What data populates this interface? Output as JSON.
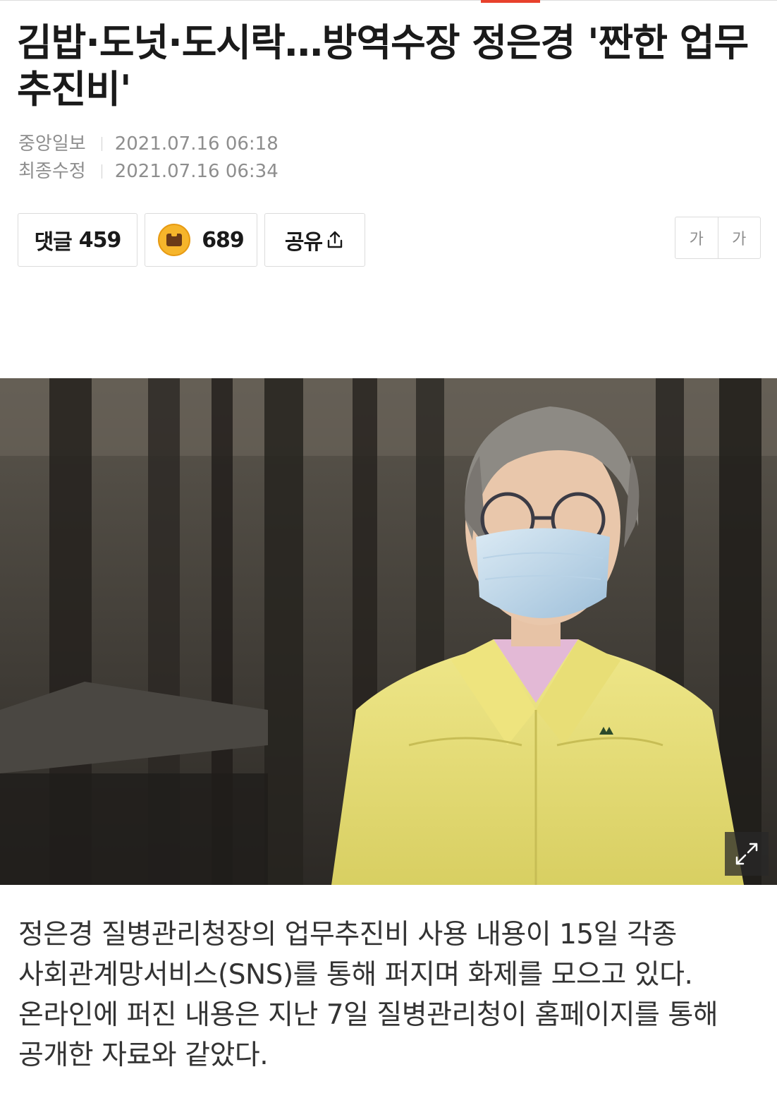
{
  "article": {
    "title": "김밥·도넛·도시락…방역수장 정은경 '짠한 업무추진비'",
    "source": "중앙일보",
    "published_at": "2021.07.16 06:18",
    "modified_label": "최종수정",
    "modified_at": "2021.07.16 06:34",
    "body": "정은경 질병관리청장의 업무추진비 사용 내용이 15일 각종 사회관계망서비스(SNS)를 통해 퍼지며 화제를 모으고 있다. 온라인에 퍼진 내용은 지난 7일 질병관리청이 홈페이지를 통해 공개한 자료와 같았다."
  },
  "actions": {
    "comment_label": "댓글",
    "comment_count": "459",
    "reaction_count": "689",
    "share_label": "공유"
  },
  "font_size": {
    "smaller": "가",
    "larger": "가"
  },
  "photo": {
    "expand_icon": "expand-icon"
  },
  "colors": {
    "accent": "#e8412c",
    "jacket": "#e8e07a"
  }
}
